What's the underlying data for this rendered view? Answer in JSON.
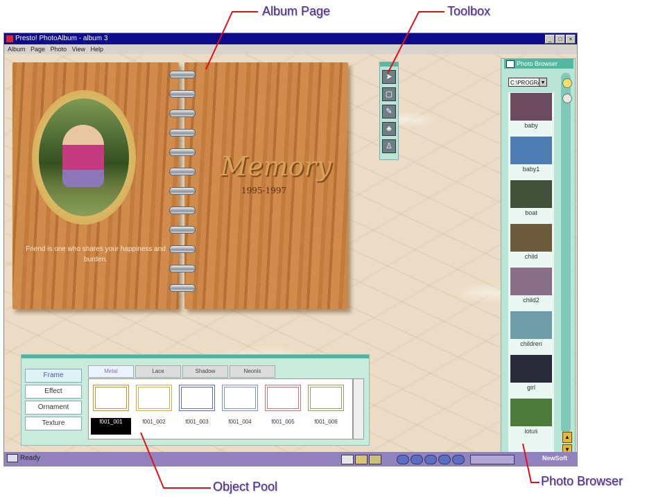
{
  "callouts": {
    "album_page": "Album Page",
    "toolbox": "Toolbox",
    "object_pool": "Object Pool",
    "photo_browser": "Photo Browser"
  },
  "window": {
    "title": "Presto! PhotoAlbum - album 3",
    "buttons": [
      "_",
      "□",
      "×"
    ]
  },
  "menu": [
    "Album",
    "Page",
    "Photo",
    "View",
    "Help"
  ],
  "album": {
    "title": "Memory",
    "years": "1995-1997",
    "caption": "Friend is one who shares your happiness and burden."
  },
  "toolbox": {
    "tools": [
      "arrow-tool-icon",
      "frame-tool-icon",
      "pencil-tool-icon",
      "stamp-tool-icon",
      "figure-tool-icon"
    ]
  },
  "photo_browser": {
    "header": "Photo Browser",
    "path": "C:\\PROGRA",
    "photos": [
      {
        "label": "baby",
        "color": "#6a4a5c"
      },
      {
        "label": "baby1",
        "color": "#4f7bb3"
      },
      {
        "label": "boat",
        "color": "#43503a"
      },
      {
        "label": "child",
        "color": "#6b5a3c"
      },
      {
        "label": "child2",
        "color": "#8a6e88"
      },
      {
        "label": "children",
        "color": "#6e9ca8"
      },
      {
        "label": "girl",
        "color": "#2a2a3a"
      },
      {
        "label": "lotus",
        "color": "#4d7a3a"
      }
    ]
  },
  "object_pool": {
    "categories": [
      "Frame",
      "Effect",
      "Ornament",
      "Texture"
    ],
    "tabs": [
      "Metal",
      "Lace",
      "Shadow",
      "Neonis"
    ],
    "frames": [
      {
        "label": "f001_001",
        "color": "#b8943c"
      },
      {
        "label": "f001_002",
        "color": "#c9b04a"
      },
      {
        "label": "f001_003",
        "color": "#5a6fa6"
      },
      {
        "label": "f001_004",
        "color": "#7a8fc4"
      },
      {
        "label": "f001_005",
        "color": "#b57a7a"
      },
      {
        "label": "f001_006",
        "color": "#8f9b6a"
      }
    ]
  },
  "status": {
    "text": "Ready",
    "brand": "NewSoft"
  }
}
